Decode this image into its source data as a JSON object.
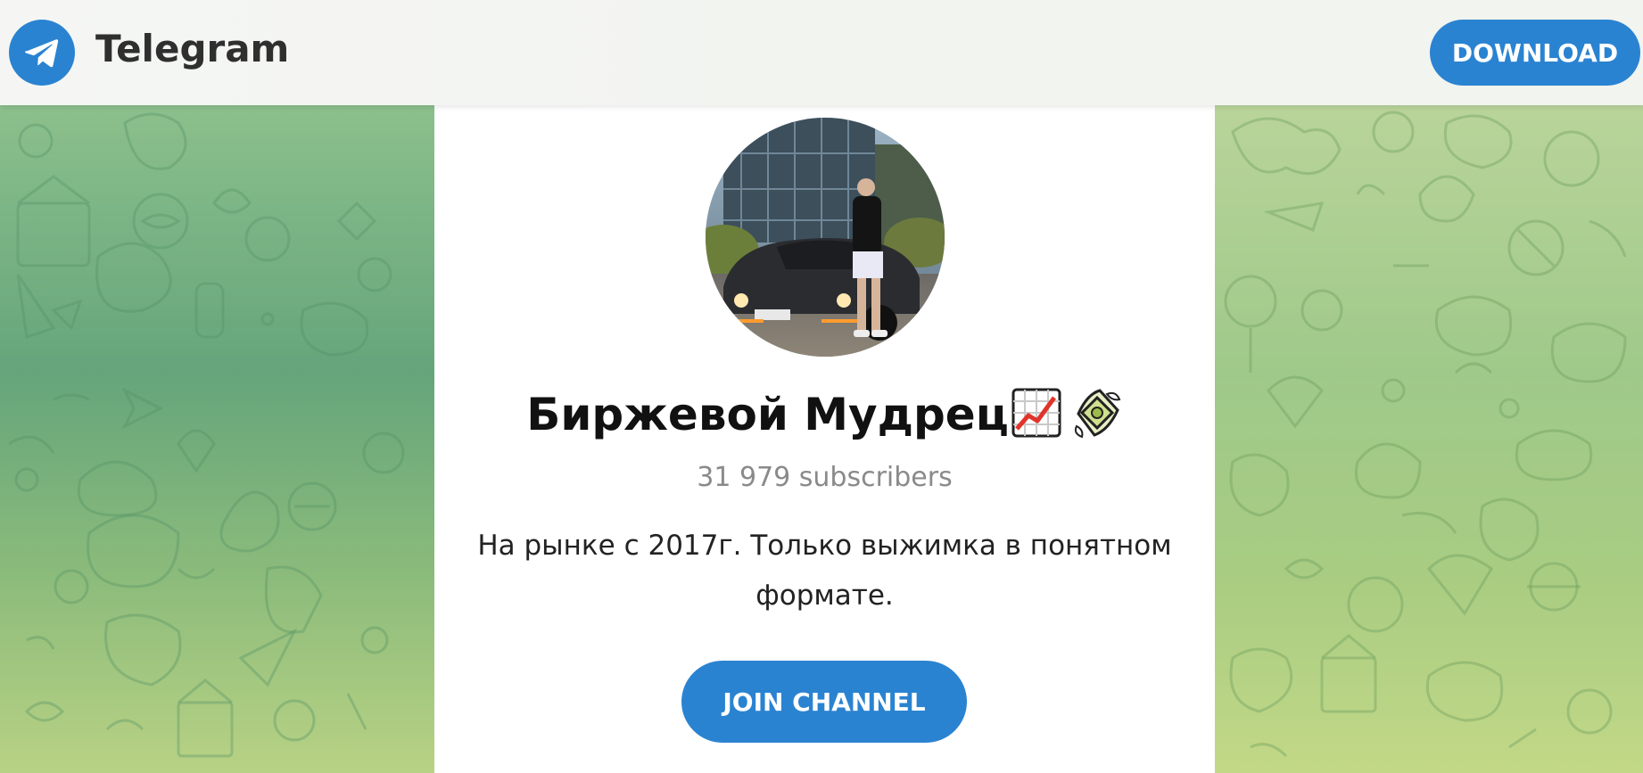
{
  "header": {
    "brand": "Telegram",
    "download_label": "DOWNLOAD",
    "logo_icon": "telegram-plane-icon"
  },
  "channel": {
    "name": "Биржевой Мудрец",
    "title_emojis": [
      "chart-increasing-emoji",
      "money-with-wings-emoji"
    ],
    "subscribers": "31 979 subscribers",
    "description": "На рынке с 2017г. Только выжимка в понятном форматe.",
    "join_label": "JOIN CHANNEL"
  },
  "colors": {
    "accent": "#2a83d1",
    "card_bg": "#ffffff",
    "pattern_green": "#6aa77e"
  }
}
